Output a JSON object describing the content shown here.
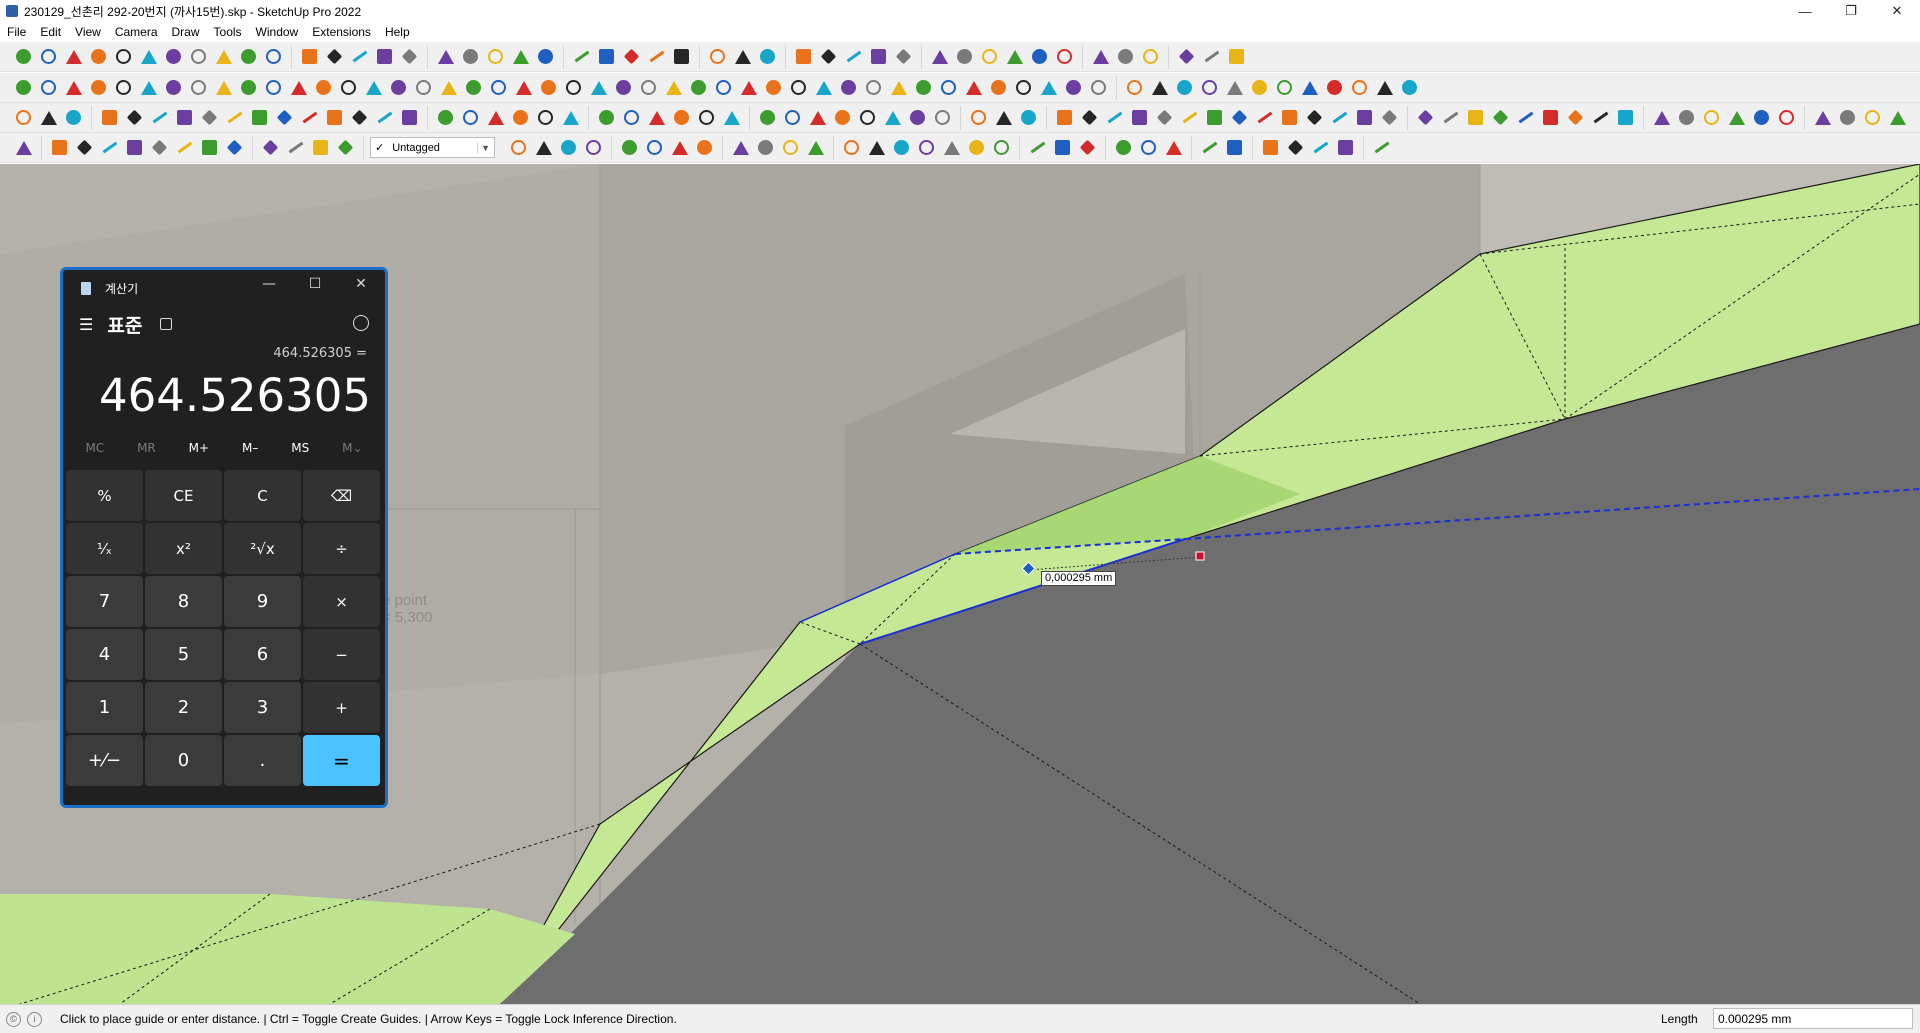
{
  "window": {
    "title": "230129_선촌리 292-20번지 (까사15번).skp - SketchUp Pro 2022",
    "minimize": "—",
    "maximize": "❐",
    "close": "✕"
  },
  "menu": [
    "File",
    "Edit",
    "View",
    "Camera",
    "Draw",
    "Tools",
    "Window",
    "Extensions",
    "Help"
  ],
  "toolbar": {
    "tag_selector": {
      "check": "✓",
      "value": "Untagged"
    },
    "colors": {
      "orange": "#e8731a",
      "red": "#d42b2b",
      "blue": "#1f5fbf",
      "green": "#3d9c2e",
      "yellow": "#e8b416",
      "gray": "#7a7a7a",
      "purple": "#6a3fa0",
      "cyan": "#17a6c9",
      "black": "#262626"
    }
  },
  "viewport": {
    "measurement_tooltip": "0,000295 mm",
    "ghost_text_line1": "e point",
    "ghost_text_line2": "= 5,300",
    "colors": {
      "background": "#b4b1aa",
      "terrain_green": "#c5e895",
      "terrain_dark": "#6e6e6e",
      "selection_blue": "#1a2fd6",
      "endpoint_red": "#c8102e"
    }
  },
  "calculator": {
    "title": "계산기",
    "mode": "표준",
    "expression": "464.526305 =",
    "display": "464.526305",
    "memory": [
      {
        "label": "MC",
        "enabled": false
      },
      {
        "label": "MR",
        "enabled": false
      },
      {
        "label": "M+",
        "enabled": true
      },
      {
        "label": "M–",
        "enabled": true
      },
      {
        "label": "MS",
        "enabled": true
      },
      {
        "label": "M⌄",
        "enabled": false
      }
    ],
    "keys": [
      {
        "label": "%",
        "type": "op",
        "name": "percent-key"
      },
      {
        "label": "CE",
        "type": "op",
        "name": "clear-entry-key"
      },
      {
        "label": "C",
        "type": "op",
        "name": "clear-key"
      },
      {
        "label": "⌫",
        "type": "op",
        "name": "backspace-key"
      },
      {
        "label": "¹⁄ₓ",
        "type": "op",
        "name": "reciprocal-key"
      },
      {
        "label": "x²",
        "type": "op",
        "name": "square-key"
      },
      {
        "label": "²√x",
        "type": "op",
        "name": "square-root-key"
      },
      {
        "label": "÷",
        "type": "op",
        "name": "divide-key"
      },
      {
        "label": "7",
        "type": "num",
        "name": "digit-7-key"
      },
      {
        "label": "8",
        "type": "num",
        "name": "digit-8-key"
      },
      {
        "label": "9",
        "type": "num",
        "name": "digit-9-key"
      },
      {
        "label": "×",
        "type": "op",
        "name": "multiply-key"
      },
      {
        "label": "4",
        "type": "num",
        "name": "digit-4-key"
      },
      {
        "label": "5",
        "type": "num",
        "name": "digit-5-key"
      },
      {
        "label": "6",
        "type": "num",
        "name": "digit-6-key"
      },
      {
        "label": "−",
        "type": "op",
        "name": "subtract-key"
      },
      {
        "label": "1",
        "type": "num",
        "name": "digit-1-key"
      },
      {
        "label": "2",
        "type": "num",
        "name": "digit-2-key"
      },
      {
        "label": "3",
        "type": "num",
        "name": "digit-3-key"
      },
      {
        "label": "+",
        "type": "op",
        "name": "add-key"
      },
      {
        "label": "+⁄−",
        "type": "num",
        "name": "negate-key"
      },
      {
        "label": "0",
        "type": "num",
        "name": "digit-0-key"
      },
      {
        "label": ".",
        "type": "num",
        "name": "decimal-key"
      },
      {
        "label": "=",
        "type": "equals",
        "name": "equals-key"
      }
    ],
    "accent_color": "#4cc2ff"
  },
  "statusbar": {
    "message": "Click to place guide or enter distance. | Ctrl = Toggle Create Guides. | Arrow Keys = Toggle Lock Inference Direction.",
    "vcb_label": "Length",
    "vcb_value": "0.000295 mm"
  }
}
